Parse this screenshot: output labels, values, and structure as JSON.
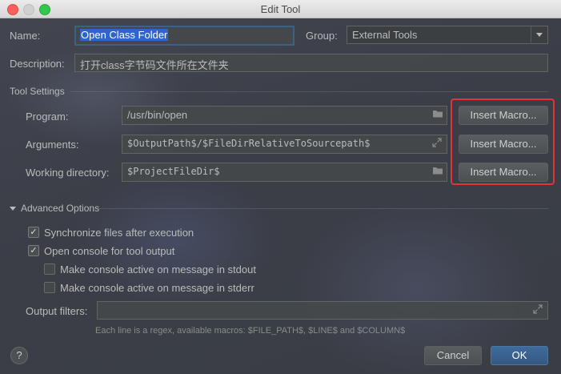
{
  "window": {
    "title": "Edit Tool"
  },
  "form": {
    "name_label": "Name:",
    "name_value": "Open Class Folder",
    "group_label": "Group:",
    "group_value": "External Tools",
    "description_label": "Description:",
    "description_value": "打开class字节码文件所在文件夹"
  },
  "tool_settings": {
    "section_title": "Tool Settings",
    "program_label": "Program:",
    "program_value": "/usr/bin/open",
    "arguments_label": "Arguments:",
    "arguments_value": "$OutputPath$/$FileDirRelativeToSourcepath$",
    "working_dir_label": "Working directory:",
    "working_dir_value": "$ProjectFileDir$",
    "insert_macro_label": "Insert Macro..."
  },
  "advanced": {
    "section_title": "Advanced Options",
    "sync_label": "Synchronize files after execution",
    "sync_checked": true,
    "open_console_label": "Open console for tool output",
    "open_console_checked": true,
    "stdout_label": "Make console active on message in stdout",
    "stdout_checked": false,
    "stderr_label": "Make console active on message in stderr",
    "stderr_checked": false,
    "output_filters_label": "Output filters:",
    "output_filters_value": "",
    "hint": "Each line is a regex, available macros: $FILE_PATH$, $LINE$ and $COLUMN$"
  },
  "footer": {
    "help_label": "?",
    "cancel_label": "Cancel",
    "ok_label": "OK"
  },
  "icons": {
    "folder": "folder-icon",
    "expand": "expand-icon",
    "check": "✓"
  },
  "colors": {
    "highlight_border": "#e8303a",
    "selection": "#2f65ca",
    "ok_button": "#365880"
  }
}
